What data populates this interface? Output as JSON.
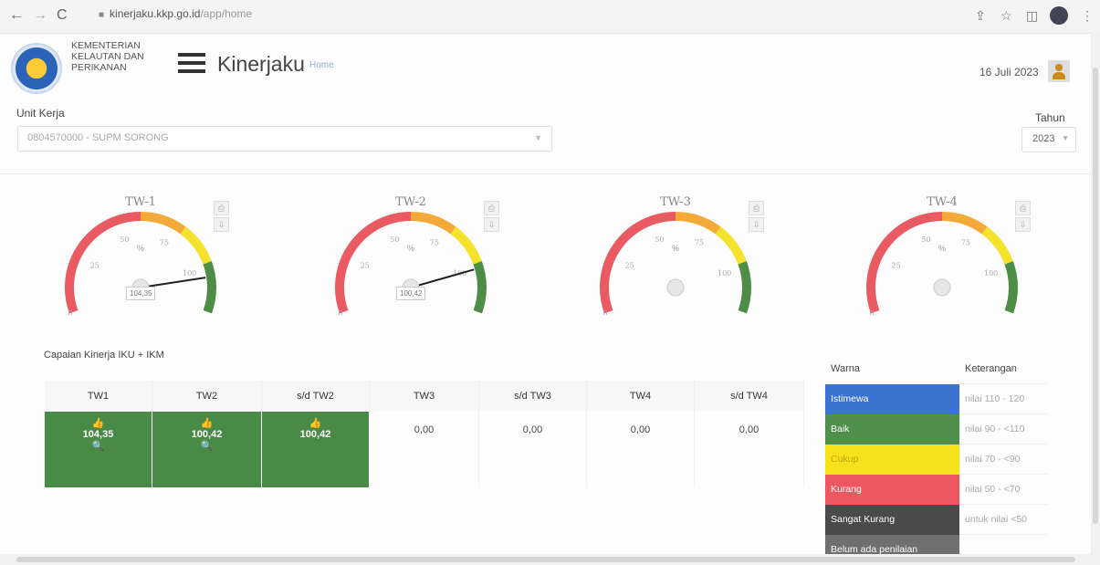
{
  "browser": {
    "url_host": "kinerjaku.kkp.go.id",
    "url_path": "/app/home"
  },
  "header": {
    "org_line1": "KEMENTERIAN",
    "org_line2": "KELAUTAN DAN",
    "org_line3": "PERIKANAN",
    "app_title": "Kinerjaku",
    "breadcrumb": "Home",
    "date": "16 Juli 2023"
  },
  "filters": {
    "unit_label": "Unit Kerja",
    "unit_value": "0804570000 - SUPM SORONG",
    "year_label": "Tahun",
    "year_value": "2023"
  },
  "gauges": [
    {
      "title": "TW-1",
      "value_label": "104,35",
      "value": 104.35,
      "needle": true
    },
    {
      "title": "TW-2",
      "value_label": "100,42",
      "value": 100.42,
      "needle": true
    },
    {
      "title": "TW-3",
      "value_label": "",
      "value": null,
      "needle": false
    },
    {
      "title": "TW-4",
      "value_label": "",
      "value": null,
      "needle": false
    }
  ],
  "gauge_scale": {
    "ticks": [
      "0",
      "25",
      "50",
      "75",
      "100"
    ],
    "unit": "%"
  },
  "capaian": {
    "title": "Capaian Kinerja IKU + IKM",
    "headers": [
      "TW1",
      "TW2",
      "s/d TW2",
      "TW3",
      "s/d TW3",
      "TW4",
      "s/d TW4"
    ],
    "values": [
      "104,35",
      "100,42",
      "100,42",
      "0,00",
      "0,00",
      "0,00",
      "0,00"
    ]
  },
  "legend": {
    "col_color": "Warna",
    "col_desc": "Keterangan",
    "rows": [
      {
        "label": "Istimewa",
        "desc": "nilai 110 - 120",
        "color": "#3b73d1"
      },
      {
        "label": "Baik",
        "desc": "nilai 90 - <110",
        "color": "#4f8e4b"
      },
      {
        "label": "Cukup",
        "desc": "nilai 70 - <90",
        "color": "#f6e21a"
      },
      {
        "label": "Kurang",
        "desc": "nilai 50 - <70",
        "color": "#ef5760"
      },
      {
        "label": "Sangat Kurang",
        "desc": "untuk nilai <50",
        "color": "#4a4a4a"
      },
      {
        "label": "Belum ada penilaian",
        "desc": "",
        "color": "#6f6f6f"
      }
    ]
  }
}
